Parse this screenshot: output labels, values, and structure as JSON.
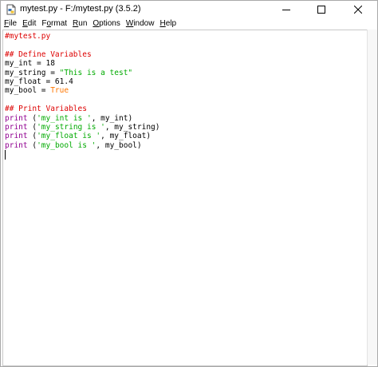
{
  "window": {
    "title": "mytest.py - F:/mytest.py (3.5.2)",
    "icon": "python-file-icon",
    "controls": [
      "minimize-icon",
      "maximize-icon",
      "close-icon"
    ]
  },
  "menu": {
    "file": "File",
    "edit": "Edit",
    "format": "Format",
    "run": "Run",
    "options": "Options",
    "window": "Window",
    "help": "Help"
  },
  "editor": {
    "colors": {
      "comment": "#dd0000",
      "string": "#00aa00",
      "builtin": "#900090",
      "keyword": "#ff7700"
    },
    "lines": [
      [
        {
          "t": "#mytest.py",
          "k": "comment"
        }
      ],
      [],
      [
        {
          "t": "## Define Variables",
          "k": "comment"
        }
      ],
      [
        {
          "t": "my_int = 18",
          "k": "plain"
        }
      ],
      [
        {
          "t": "my_string = ",
          "k": "plain"
        },
        {
          "t": "\"This is a test\"",
          "k": "string"
        }
      ],
      [
        {
          "t": "my_float = 61.4",
          "k": "plain"
        }
      ],
      [
        {
          "t": "my_bool = ",
          "k": "plain"
        },
        {
          "t": "True",
          "k": "keyword"
        }
      ],
      [],
      [
        {
          "t": "## Print Variables",
          "k": "comment"
        }
      ],
      [
        {
          "t": "print",
          "k": "builtin"
        },
        {
          "t": " (",
          "k": "plain"
        },
        {
          "t": "'my_int is '",
          "k": "string"
        },
        {
          "t": ", my_int)",
          "k": "plain"
        }
      ],
      [
        {
          "t": "print",
          "k": "builtin"
        },
        {
          "t": " (",
          "k": "plain"
        },
        {
          "t": "'my_string is '",
          "k": "string"
        },
        {
          "t": ", my_string)",
          "k": "plain"
        }
      ],
      [
        {
          "t": "print",
          "k": "builtin"
        },
        {
          "t": " (",
          "k": "plain"
        },
        {
          "t": "'my_float is '",
          "k": "string"
        },
        {
          "t": ", my_float)",
          "k": "plain"
        }
      ],
      [
        {
          "t": "print",
          "k": "builtin"
        },
        {
          "t": " (",
          "k": "plain"
        },
        {
          "t": "'my_bool is '",
          "k": "string"
        },
        {
          "t": ", my_bool)",
          "k": "plain"
        }
      ],
      [
        {
          "t": "",
          "k": "cursor"
        }
      ]
    ]
  }
}
